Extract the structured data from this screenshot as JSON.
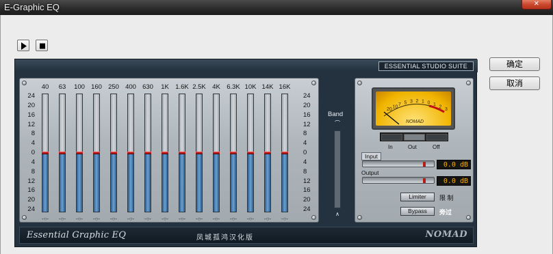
{
  "window": {
    "title": "E-Graphic EQ"
  },
  "transport": {
    "play_icon": "play-icon",
    "stop_icon": "stop-icon"
  },
  "dialog": {
    "ok_label": "确定",
    "cancel_label": "取消"
  },
  "plugin": {
    "suite_label": "ESSENTIAL STUDIO SUITE",
    "eq": {
      "bands": [
        "40",
        "63",
        "100",
        "160",
        "250",
        "400",
        "630",
        "1K",
        "1.6K",
        "2.5K",
        "4K",
        "6.3K",
        "10K",
        "14K",
        "16K"
      ],
      "gains": [
        0,
        0,
        0,
        0,
        0,
        0,
        0,
        0,
        0,
        0,
        0,
        0,
        0,
        0,
        0
      ],
      "scale": [
        "24",
        "20",
        "16",
        "12",
        "8",
        "4",
        "0",
        "4",
        "8",
        "12",
        "16",
        "20",
        "24"
      ]
    },
    "band": {
      "label": "Band",
      "value": 0
    },
    "meter": {
      "scale": [
        "20",
        "10",
        "7",
        "5",
        "3",
        "2",
        "1",
        "0",
        "1",
        "2",
        "3"
      ],
      "brand": "NOMAD",
      "modes": [
        "In",
        "Out",
        "Off"
      ],
      "selected_mode": "Out"
    },
    "input": {
      "label": "Input",
      "value": "0.0 dB",
      "level": 0.88
    },
    "output": {
      "label": "Output",
      "value": "0.0 dB",
      "level": 0.88
    },
    "limiter": {
      "label": "Limiter",
      "cn": "限 制"
    },
    "bypass": {
      "label": "Bypass",
      "cn": "旁过"
    },
    "footer": {
      "product": "Essential Graphic EQ",
      "credit": "凤城孤鸿汉化版",
      "logo": "NOMAD"
    }
  },
  "colors": {
    "knob": "#b31d1d",
    "readout": "#ffb000",
    "meter_face": "#f0b400"
  }
}
